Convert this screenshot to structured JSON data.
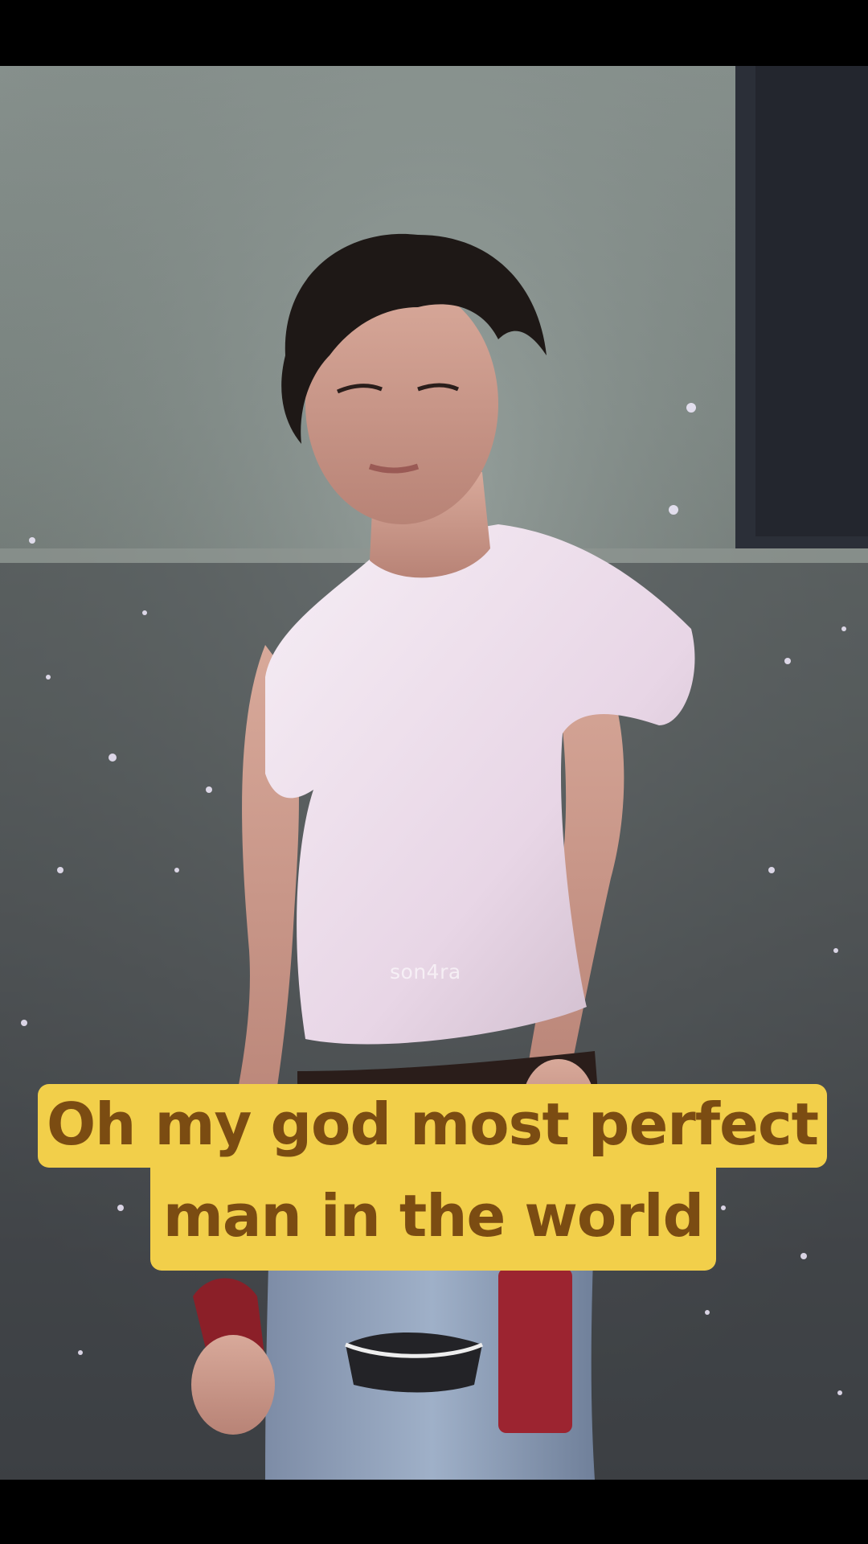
{
  "video": {
    "watermark": "son4ra"
  },
  "caption": {
    "line1": "Oh my god most perfect",
    "line2": "man in the world"
  },
  "colors": {
    "caption_bg": "#f2cf4a",
    "caption_text": "#7b4c12",
    "letterbox": "#000000"
  }
}
